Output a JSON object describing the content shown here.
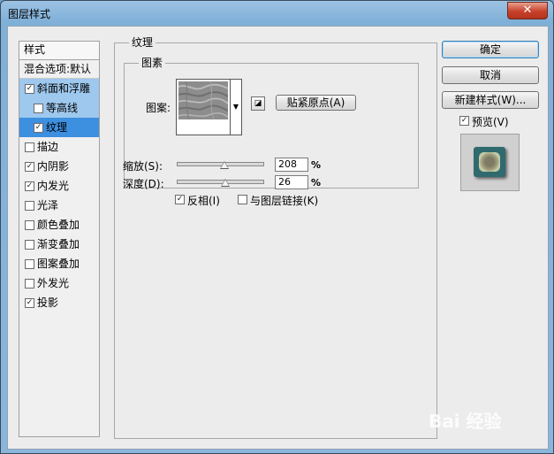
{
  "window": {
    "title": "图层样式",
    "close_label": "✕"
  },
  "styles_list": {
    "header": "样式",
    "blend_options": "混合选项:默认",
    "items": [
      {
        "label": "斜面和浮雕",
        "checked": true,
        "sub": false,
        "state": "active"
      },
      {
        "label": "等高线",
        "checked": false,
        "sub": true,
        "state": "active"
      },
      {
        "label": "纹理",
        "checked": true,
        "sub": true,
        "state": "selected"
      },
      {
        "label": "描边",
        "checked": false,
        "sub": false,
        "state": ""
      },
      {
        "label": "内阴影",
        "checked": true,
        "sub": false,
        "state": ""
      },
      {
        "label": "内发光",
        "checked": true,
        "sub": false,
        "state": ""
      },
      {
        "label": "光泽",
        "checked": false,
        "sub": false,
        "state": ""
      },
      {
        "label": "颜色叠加",
        "checked": false,
        "sub": false,
        "state": ""
      },
      {
        "label": "渐变叠加",
        "checked": false,
        "sub": false,
        "state": ""
      },
      {
        "label": "图案叠加",
        "checked": false,
        "sub": false,
        "state": ""
      },
      {
        "label": "外发光",
        "checked": false,
        "sub": false,
        "state": ""
      },
      {
        "label": "投影",
        "checked": true,
        "sub": false,
        "state": ""
      }
    ]
  },
  "texture": {
    "group_title": "纹理",
    "subgroup_title": "图素",
    "pattern_label": "图案:",
    "snap_label": "贴紧原点(A)",
    "scale_label": "缩放(S):",
    "scale_value": "208",
    "scale_unit": "%",
    "scale_level": 0.55,
    "depth_label": "深度(D):",
    "depth_value": "26",
    "depth_unit": "%",
    "depth_level": 0.56,
    "invert_label": "反相(I)",
    "invert_checked": true,
    "link_label": "与图层链接(K)",
    "link_checked": false
  },
  "buttons": {
    "ok": "确定",
    "cancel": "取消",
    "new_style": "新建样式(W)..."
  },
  "preview": {
    "label": "预览(V)",
    "checked": true
  },
  "watermark": "Bai 经验",
  "icons": [
    "close-icon",
    "checkbox-checked-icon",
    "dropdown-arrow-icon",
    "new-preset-icon",
    "slider-thumb-icon"
  ]
}
